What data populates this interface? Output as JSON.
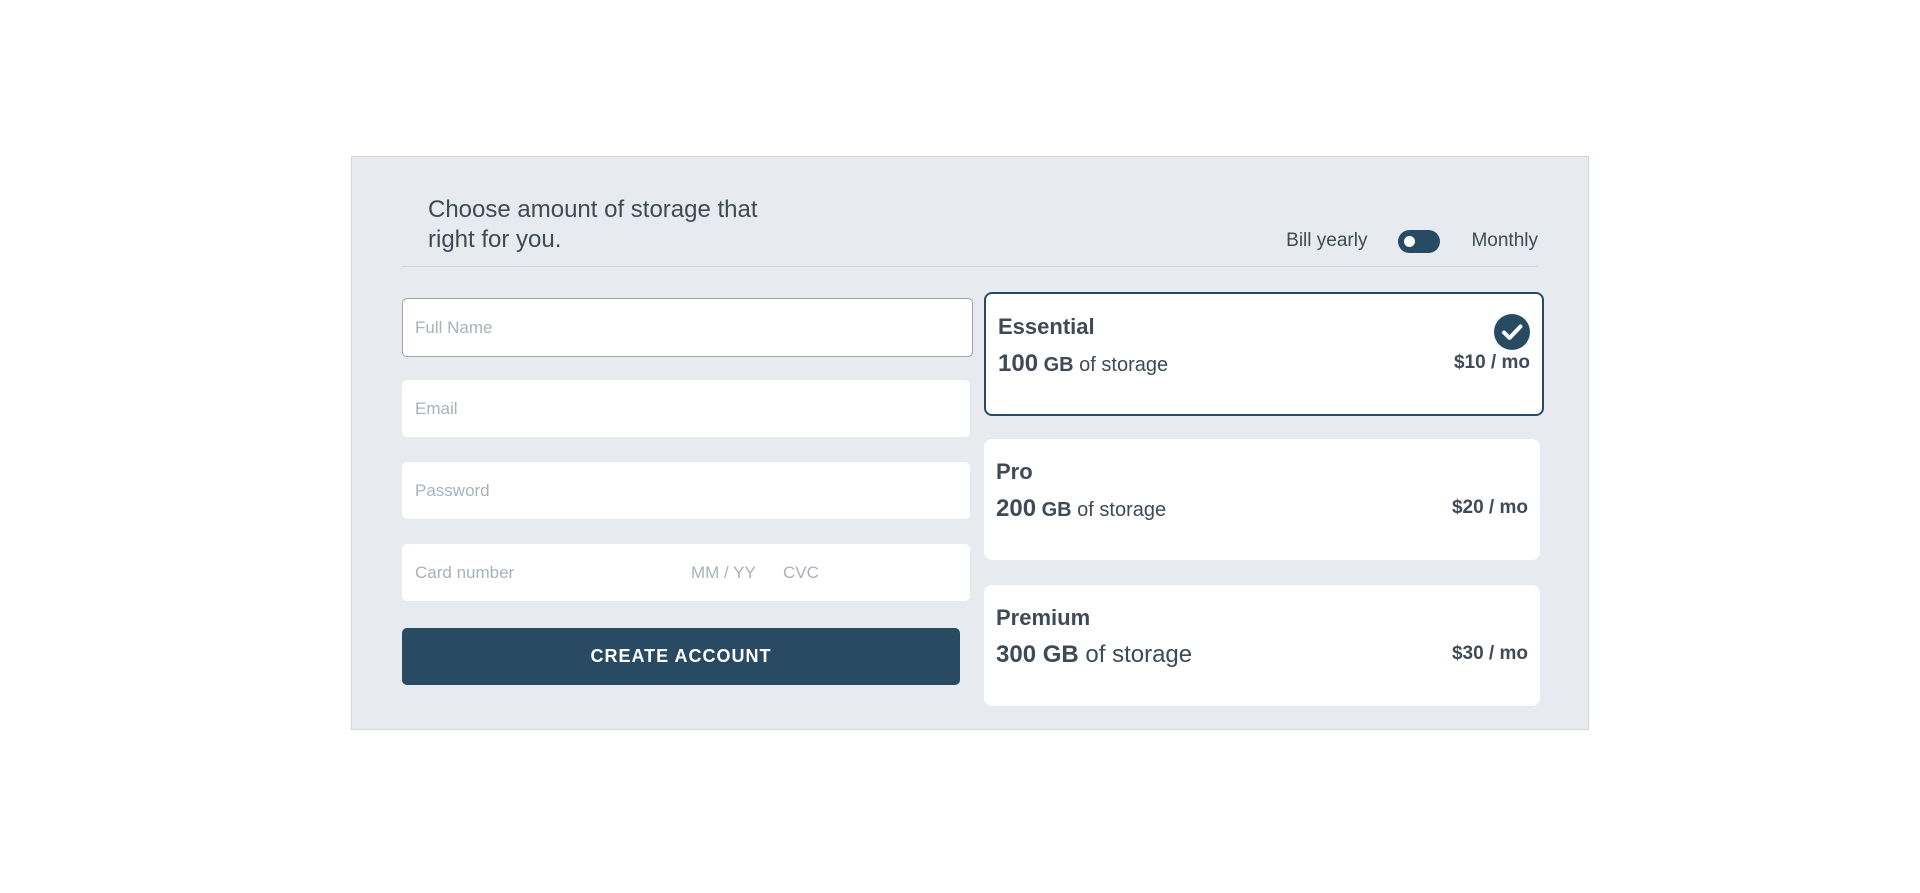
{
  "header": {
    "title": "Choose amount of storage that right for you.",
    "billing": {
      "yearly_label": "Bill yearly",
      "monthly_label": "Monthly"
    }
  },
  "form": {
    "full_name": {
      "placeholder": "Full Name",
      "value": ""
    },
    "email": {
      "placeholder": "Email",
      "value": ""
    },
    "password": {
      "placeholder": "Password",
      "value": ""
    },
    "card_number": {
      "placeholder": "Card number"
    },
    "expiry": {
      "placeholder": "MM / YY"
    },
    "cvc": {
      "placeholder": "CVC"
    },
    "submit_label": "CREATE ACCOUNT"
  },
  "plans": [
    {
      "name": "Essential",
      "amount": "100",
      "unit": "GB",
      "suffix": "of storage",
      "price": "$10 / mo",
      "selected": true
    },
    {
      "name": "Pro",
      "amount": "200",
      "unit": "GB",
      "suffix": "of storage",
      "price": "$20 / mo",
      "selected": false
    },
    {
      "name": "Premium",
      "amount": "300",
      "unit": "GB",
      "suffix": "of storage",
      "price": "$30 / mo",
      "selected": false
    }
  ],
  "icons": {
    "selected": "check-circle-icon"
  },
  "colors": {
    "accent": "#284b63",
    "panel_bg": "#e7ebef",
    "text": "#3f4a56"
  }
}
